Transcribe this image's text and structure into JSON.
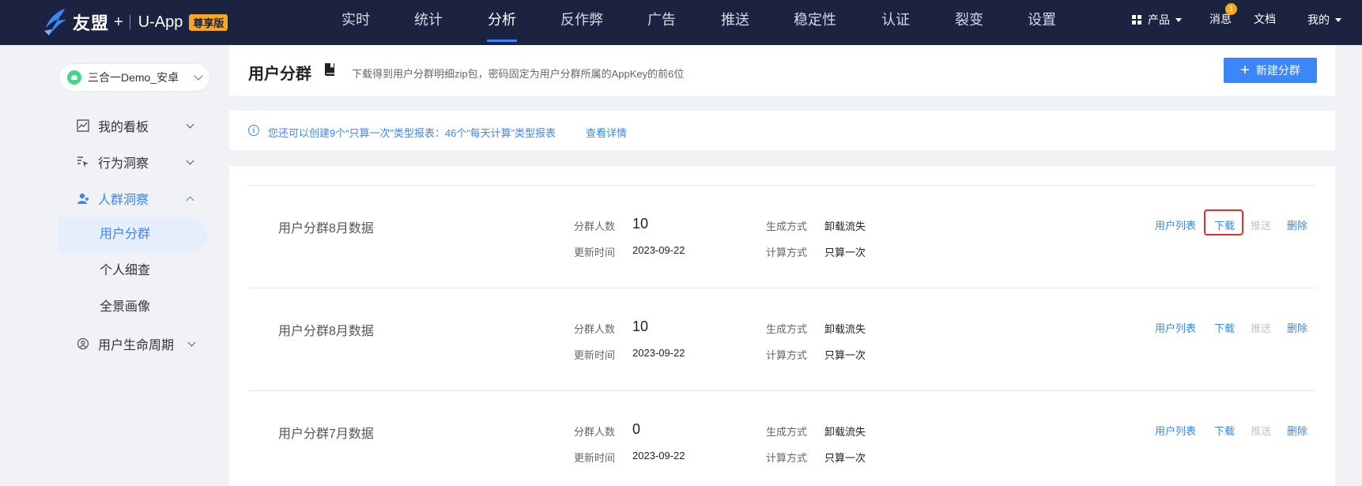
{
  "topbar": {
    "brand": "友盟",
    "plus": "+",
    "product": "U-App",
    "edition_badge": "尊享版",
    "nav": [
      "实时",
      "统计",
      "分析",
      "反作弊",
      "广告",
      "推送",
      "稳定性",
      "认证",
      "裂变",
      "设置"
    ],
    "active_nav": "分析",
    "right": {
      "products": "产品",
      "messages": "消息",
      "message_count": "1",
      "docs": "文档",
      "mine": "我的"
    }
  },
  "sidebar": {
    "app_name": "三合一Demo_安卓",
    "items": [
      {
        "label": "我的看板",
        "icon": "chart-line-icon"
      },
      {
        "label": "行为洞察",
        "icon": "cursor-list-icon"
      },
      {
        "label": "人群洞察",
        "icon": "user-group-icon"
      },
      {
        "label": "用户生命周期",
        "icon": "lifecycle-icon"
      }
    ],
    "sub_items": [
      "用户分群",
      "个人细查",
      "全景画像"
    ],
    "active_sub": "用户分群"
  },
  "header": {
    "title": "用户分群",
    "description": "下载得到用户分群明细zip包，密码固定为用户分群所属的AppKey的前6位",
    "new_button": "新建分群"
  },
  "info": {
    "text": "您还可以创建9个“只算一次”类型报表：46个“每天计算”类型报表",
    "link": "查看详情"
  },
  "labels": {
    "count": "分群人数",
    "updated": "更新时间",
    "method": "生成方式",
    "calc": "计算方式"
  },
  "actions": {
    "user_list": "用户列表",
    "download": "下载",
    "push": "推送",
    "delete": "删除"
  },
  "segments": [
    {
      "name": "用户分群8月数据",
      "count": "10",
      "updated": "2023-09-22",
      "method": "卸载流失",
      "calc": "只算一次"
    },
    {
      "name": "用户分群8月数据",
      "count": "10",
      "updated": "2023-09-22",
      "method": "卸载流失",
      "calc": "只算一次"
    },
    {
      "name": "用户分群7月数据",
      "count": "0",
      "updated": "2023-09-22",
      "method": "卸载流失",
      "calc": "只算一次"
    }
  ],
  "colors": {
    "topbar": "#1c2340",
    "accent": "#3d86f7",
    "badge": "#f5a623",
    "highlight": "#e0302b"
  }
}
